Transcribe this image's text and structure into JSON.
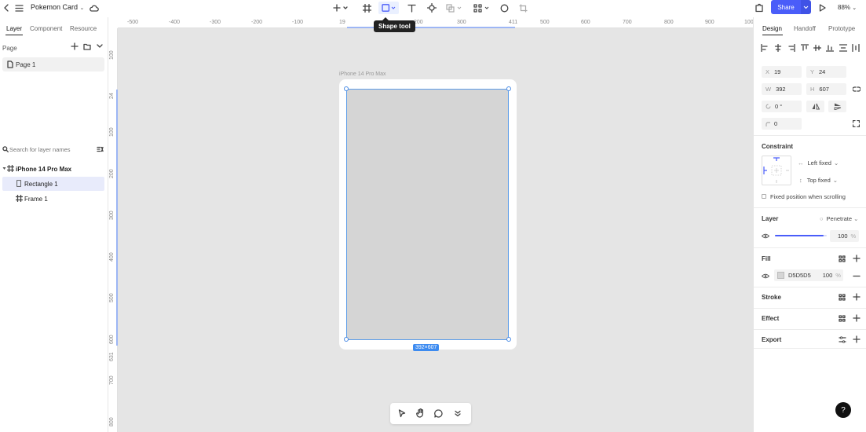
{
  "header": {
    "file_title": "Pokemon Card",
    "share_label": "Share",
    "zoom": "88%",
    "tooltip": "Shape tool"
  },
  "left_panel": {
    "tabs": [
      "Layer",
      "Component",
      "Resource"
    ],
    "page_section_label": "Page",
    "pages": [
      "Page 1"
    ],
    "search_placeholder": "Search for layer names",
    "layers": [
      {
        "label": "iPhone 14 Pro Max",
        "type": "frame"
      },
      {
        "label": "Rectangle 1",
        "type": "rectangle",
        "selected": true
      },
      {
        "label": "Frame 1",
        "type": "frame"
      }
    ]
  },
  "canvas": {
    "ruler_top": [
      "-500",
      "-400",
      "-300",
      "-200",
      "-100",
      "19",
      "200",
      "300",
      "411",
      "500",
      "600",
      "700",
      "800",
      "900",
      "100"
    ],
    "ruler_top_highlight": "100",
    "ruler_left": [
      "100",
      "24",
      "100",
      "200",
      "300",
      "400",
      "500",
      "600",
      "631",
      "700",
      "800"
    ],
    "frame_label": "iPhone 14 Pro Max",
    "size_badge": "392×607"
  },
  "right_panel": {
    "tabs": [
      "Design",
      "Handoff",
      "Prototype"
    ],
    "x_label": "X",
    "x_value": "19",
    "y_label": "Y",
    "y_value": "24",
    "w_label": "W",
    "w_value": "392",
    "h_label": "H",
    "h_value": "607",
    "rotation": "0 °",
    "radius": "0",
    "constraint_title": "Constraint",
    "constraint_h": "Left fixed",
    "constraint_v": "Top fixed",
    "fixed_position_label": "Fixed position when scrolling",
    "layer_title": "Layer",
    "blend_mode": "Penetrate",
    "layer_opacity": "100",
    "percent": "%",
    "fill_title": "Fill",
    "fill_hex": "D5D5D5",
    "fill_opacity": "100",
    "stroke_title": "Stroke",
    "effect_title": "Effect",
    "export_title": "Export",
    "help": "?"
  },
  "colors": {
    "accent": "#4a5df9",
    "selection": "#3d8bf0",
    "fill": "#D5D5D5"
  }
}
